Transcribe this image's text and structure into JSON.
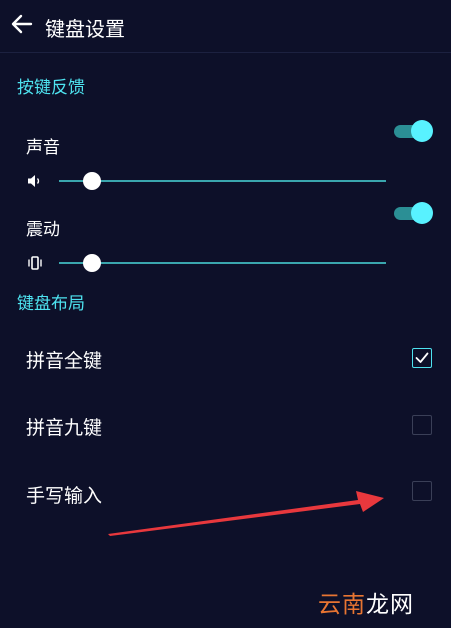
{
  "header": {
    "title": "键盘设置",
    "back_icon": "arrow-left-icon"
  },
  "key_feedback": {
    "section_title": "按键反馈",
    "sound": {
      "label": "声音",
      "enabled": true,
      "volume_level": 0.1,
      "icon": "speaker-icon"
    },
    "vibration": {
      "label": "震动",
      "enabled": true,
      "strength_level": 0.1,
      "icon": "vibrate-icon"
    }
  },
  "keyboard_layout": {
    "section_title": "键盘布局",
    "options": [
      {
        "label": "拼音全键",
        "checked": true
      },
      {
        "label": "拼音九键",
        "checked": false
      },
      {
        "label": "手写输入",
        "checked": false
      }
    ]
  },
  "watermark": {
    "part1": "云南",
    "part2": "龙网"
  },
  "colors": {
    "background": "#0d1029",
    "accent": "#4ee3f0",
    "toggle_knob": "#58f2ff",
    "annotation_arrow": "#e8383d"
  }
}
